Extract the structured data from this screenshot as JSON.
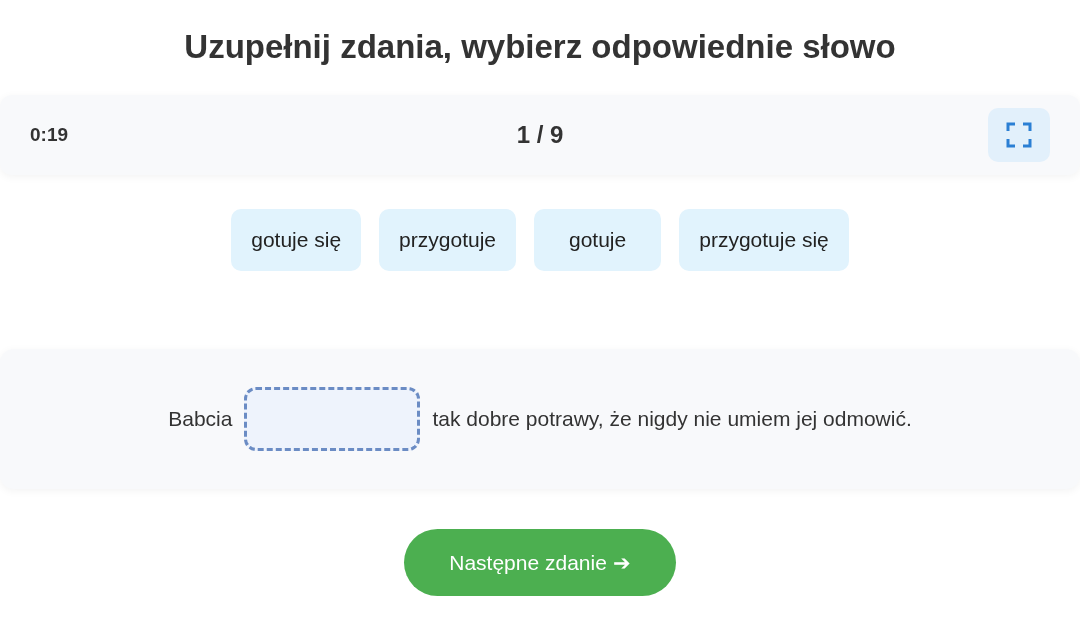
{
  "title": "Uzupełnij zdania, wybierz odpowiednie słowo",
  "toolbar": {
    "timer": "0:19",
    "progress": "1 / 9"
  },
  "words": [
    {
      "label": "gotuje się"
    },
    {
      "label": "przygotuje"
    },
    {
      "label": "gotuje"
    },
    {
      "label": "przygotuje się"
    }
  ],
  "sentence": {
    "before": "Babcia",
    "after": "tak dobre potrawy, że nigdy nie umiem jej odmowić."
  },
  "next_button": "Następne zdanie ➔"
}
